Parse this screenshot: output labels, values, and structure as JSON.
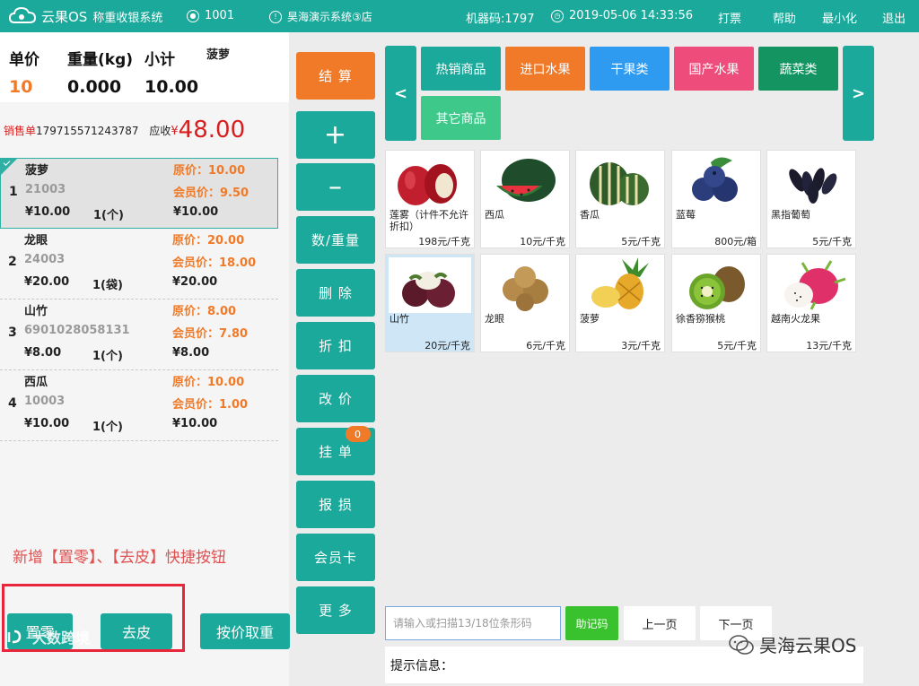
{
  "topbar": {
    "brand": "云果OS",
    "subtitle": "称重收银系统",
    "user_id": "1001",
    "store": "昊海演示系统③店",
    "machine": "机器码:1797",
    "datetime": "2019-05-06 14:33:56",
    "print": "打票",
    "help": "帮助",
    "minimize": "最小化",
    "exit": "退出"
  },
  "scale": {
    "unit_price_label": "单价",
    "weight_label": "重量(kg)",
    "subtotal_label": "小计",
    "product": "菠萝",
    "unit_price": "10",
    "weight": "0.000",
    "subtotal": "10.00"
  },
  "order": {
    "label": "销售单",
    "number": "179715571243787",
    "due_label": "应收",
    "currency": "¥",
    "amount": "48.00"
  },
  "items": [
    {
      "idx": "1",
      "name": "菠萝",
      "code": "21003",
      "price": "¥10.00",
      "qty": "1(个)",
      "orig": "原价：10.00",
      "member": "会员价：9.50",
      "subtotal": "¥10.00"
    },
    {
      "idx": "2",
      "name": "龙眼",
      "code": "24003",
      "price": "¥20.00",
      "qty": "1(袋)",
      "orig": "原价：20.00",
      "member": "会员价：18.00",
      "subtotal": "¥20.00"
    },
    {
      "idx": "3",
      "name": "山竹",
      "code": "6901028058131",
      "price": "¥8.00",
      "qty": "1(个)",
      "orig": "原价：8.00",
      "member": "会员价：7.80",
      "subtotal": "¥8.00"
    },
    {
      "idx": "4",
      "name": "西瓜",
      "code": "10003",
      "price": "¥10.00",
      "qty": "1(个)",
      "orig": "原价：10.00",
      "member": "会员价：1.00",
      "subtotal": "¥10.00"
    }
  ],
  "note": "新增【置零】、【去皮】快捷按钮",
  "bottom_buttons": {
    "zero": "置零",
    "tare": "去皮",
    "by_price": "按价取重"
  },
  "watermark": "大数跨境",
  "actions": {
    "checkout": "结 算",
    "plus": "+",
    "minus": "–",
    "qty_weight": "数/重量",
    "delete": "删 除",
    "discount": "折 扣",
    "change_price": "改 价",
    "hold": "挂 单",
    "hold_count": "0",
    "loss": "报 损",
    "member_card": "会员卡",
    "more": "更 多"
  },
  "nav": {
    "prev": "<",
    "next": ">"
  },
  "categories": [
    {
      "label": "热销商品",
      "color": "#1aa99a"
    },
    {
      "label": "进口水果",
      "color": "#f07a28"
    },
    {
      "label": "干果类",
      "color": "#2f9bf0"
    },
    {
      "label": "国产水果",
      "color": "#ee4d7b"
    },
    {
      "label": "蔬菜类",
      "color": "#149460"
    },
    {
      "label": "其它商品",
      "color": "#3ec88a"
    }
  ],
  "products": [
    {
      "name": "莲雾（计件不允许折扣）",
      "price": "198元/千克",
      "icon": "wax-apple-icon"
    },
    {
      "name": "西瓜",
      "price": "10元/千克",
      "icon": "watermelon-icon"
    },
    {
      "name": "香瓜",
      "price": "5元/千克",
      "icon": "melon-icon"
    },
    {
      "name": "蓝莓",
      "price": "800元/箱",
      "icon": "blueberry-icon"
    },
    {
      "name": "黑指葡萄",
      "price": "5元/千克",
      "icon": "grape-icon"
    },
    {
      "name": "山竹",
      "price": "20元/千克",
      "icon": "mangosteen-icon"
    },
    {
      "name": "龙眼",
      "price": "6元/千克",
      "icon": "longan-icon"
    },
    {
      "name": "菠萝",
      "price": "3元/千克",
      "icon": "pineapple-icon"
    },
    {
      "name": "徐香猕猴桃",
      "price": "5元/千克",
      "icon": "kiwi-icon"
    },
    {
      "name": "越南火龙果",
      "price": "13元/千克",
      "icon": "dragonfruit-icon"
    }
  ],
  "search": {
    "placeholder": "请输入或扫描13/18位条形码"
  },
  "mnemonic": "助记码",
  "paging": {
    "prev": "上一页",
    "next": "下一页"
  },
  "tips_label": "提示信息：",
  "brand_watermark": "昊海云果OS"
}
